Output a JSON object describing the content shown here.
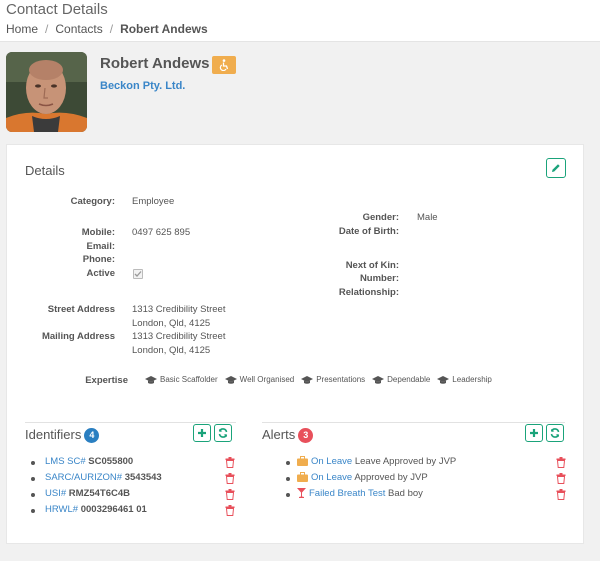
{
  "page_title": "Contact Details",
  "breadcrumb": {
    "home": "Home",
    "contacts": "Contacts",
    "current": "Robert Andews",
    "separator": "/"
  },
  "person": {
    "name": "Robert Andews",
    "company": "Beckon Pty. Ltd.",
    "badge_icon": "accessibility-icon"
  },
  "details": {
    "title": "Details",
    "fields": {
      "category_label": "Category:",
      "category_value": "Employee",
      "mobile_label": "Mobile:",
      "mobile_value": "0497 625 895",
      "email_label": "Email:",
      "phone_label": "Phone:",
      "active_label": "Active",
      "gender_label": "Gender:",
      "gender_value": "Male",
      "dob_label": "Date of Birth:",
      "nok_label": "Next of Kin:",
      "number_label": "Number:",
      "relationship_label": "Relationship:",
      "street_label": "Street Address",
      "street_line1": "1313 Credibility Street",
      "street_line2": "London, Qld, 4125",
      "mailing_label": "Mailing Address",
      "mailing_line1": "1313 Credibility Street",
      "mailing_line2": "London, Qld, 4125"
    },
    "expertise_label": "Expertise",
    "expertise": [
      "Basic Scaffolder",
      "Well Organised",
      "Presentations",
      "Dependable",
      "Leadership"
    ]
  },
  "identifiers": {
    "title": "Identifiers",
    "count": "4",
    "items": [
      {
        "type": "LMS SC#",
        "value": "SC055800"
      },
      {
        "type": "SARC/AURIZON#",
        "value": "3543543"
      },
      {
        "type": "USI#",
        "value": "RMZ54T6C4B"
      },
      {
        "type": "HRWL#",
        "value": "0003296461 01"
      }
    ]
  },
  "alerts": {
    "title": "Alerts",
    "count": "3",
    "items": [
      {
        "icon": "briefcase-icon",
        "title": "On Leave",
        "text": "Leave Approved by JVP"
      },
      {
        "icon": "briefcase-icon",
        "title": "On Leave",
        "text": "Approved by JVP"
      },
      {
        "icon": "cocktail-glass-icon",
        "title": "Failed Breath Test",
        "text": "Bad boy"
      }
    ]
  },
  "colors": {
    "accent": "#1aa37a",
    "link": "#3a86c8",
    "badge": "#f0ad4e",
    "identifiers_count": "#2a7fc1",
    "alerts_count": "#e8505b",
    "danger": "#e8505b"
  }
}
